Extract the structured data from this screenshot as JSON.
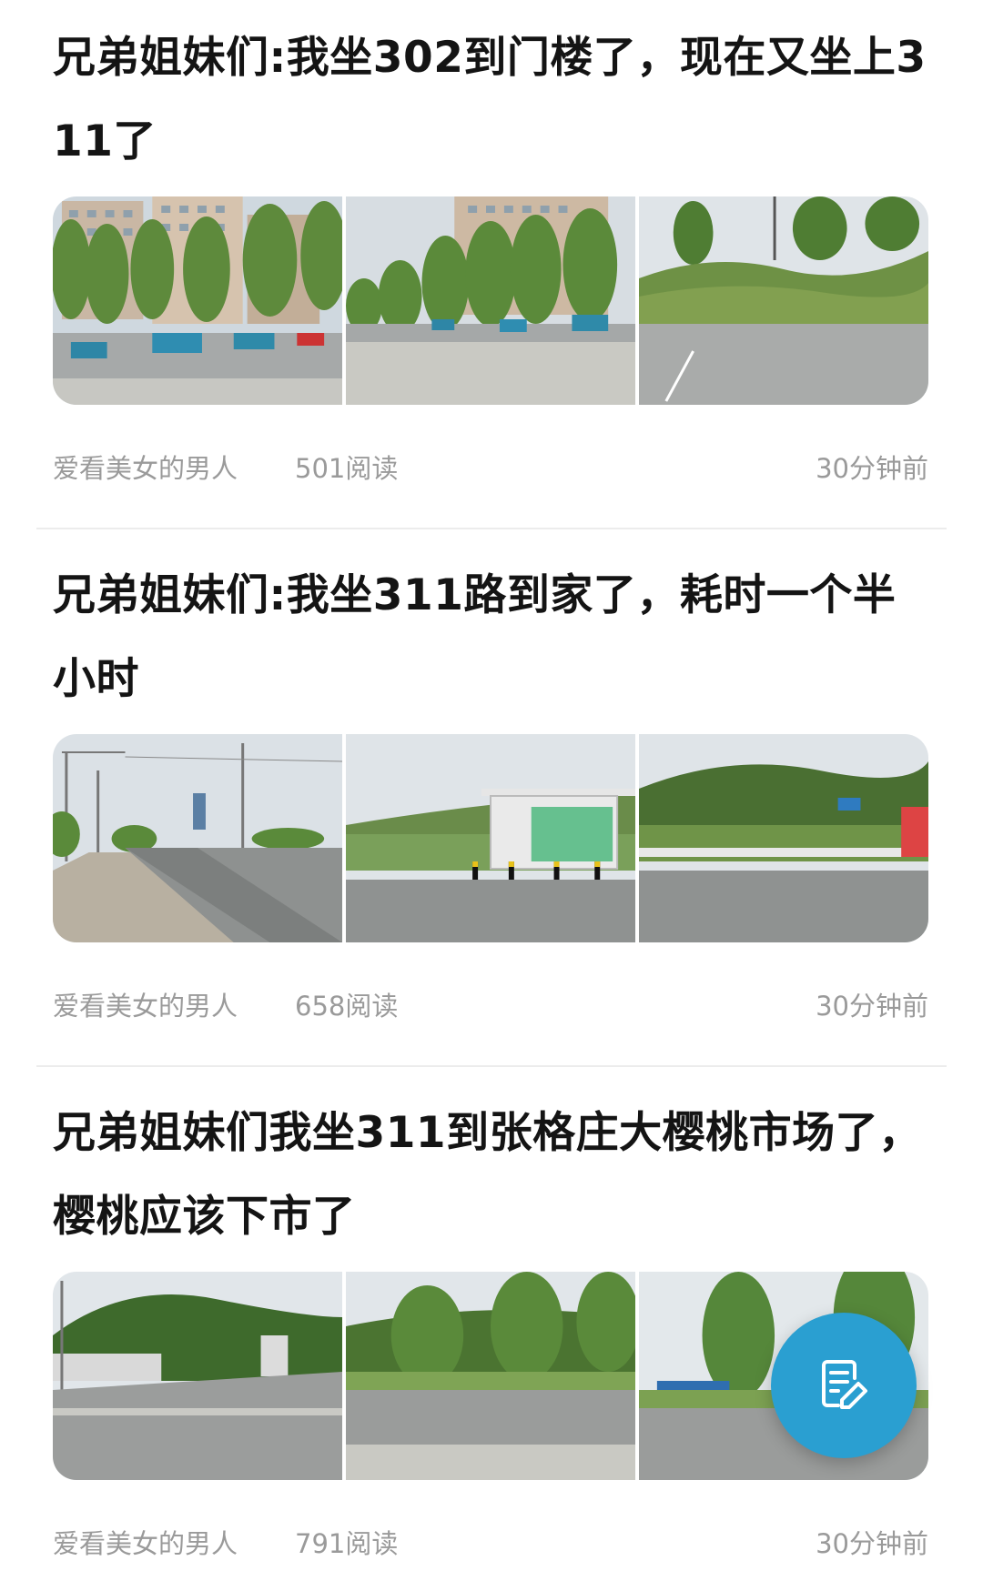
{
  "posts": [
    {
      "title": "兄弟姐妹们:我坐302到门楼了，现在又坐上311了",
      "author": "爱看美女的男人",
      "reads": "501阅读",
      "time": "30分钟前",
      "images": [
        "apartment-buildings-street",
        "road-with-trees-buildings",
        "roadside-hill-power-line"
      ]
    },
    {
      "title": "兄弟姐妹们:我坐311路到家了，耗时一个半小时",
      "author": "爱看美女的男人",
      "reads": "658阅读",
      "time": "30分钟前",
      "images": [
        "empty-road-utility-poles",
        "bus-stop-shelter",
        "hills-roadside-sign"
      ]
    },
    {
      "title": "兄弟姐妹们我坐311到张格庄大樱桃市场了，樱桃应该下市了",
      "author": "爱看美女的男人",
      "reads": "791阅读",
      "time": "30分钟前",
      "images": [
        "intersection-with-hill",
        "road-with-trees",
        "roadside-trees-fence"
      ]
    }
  ],
  "fab": {
    "icon": "edit-note-icon",
    "color": "#2a9fd1"
  }
}
